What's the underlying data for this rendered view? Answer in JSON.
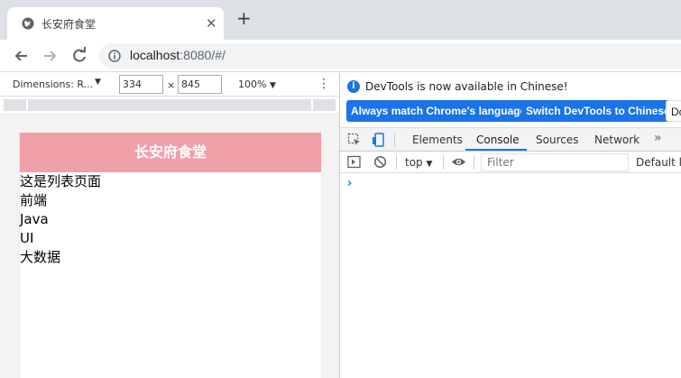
{
  "browser": {
    "tab_title": "长安府食堂",
    "new_tab_label": "+",
    "tab_close_label": "✕",
    "url_host": "localhost",
    "url_path": ":8080/#/"
  },
  "device_toolbar": {
    "dimensions_label": "Dimensions: R...",
    "width_value": "334",
    "height_value": "845",
    "times_symbol": "×",
    "zoom_label": "100%",
    "dropdown_arrow": "▼",
    "more_label": "⋮"
  },
  "app": {
    "header_title": "长安府食堂",
    "list_title": "这是列表页面",
    "items": [
      "前端",
      "Java",
      "UI",
      "大数据"
    ]
  },
  "devtools": {
    "banner_message": "DevTools is now available in Chinese!",
    "btn_always_match": "Always match Chrome's language",
    "btn_switch": "Switch DevTools to Chinese",
    "btn_dont": "Don't show again",
    "tabs": [
      "Elements",
      "Console",
      "Sources",
      "Network"
    ],
    "more_tabs": "»",
    "context_label": "top",
    "filter_placeholder": "Filter",
    "levels_label": "Default levels",
    "prompt_symbol": "›"
  },
  "colors": {
    "header_bg": "#f0a1a8",
    "accent": "#1a73e8"
  }
}
